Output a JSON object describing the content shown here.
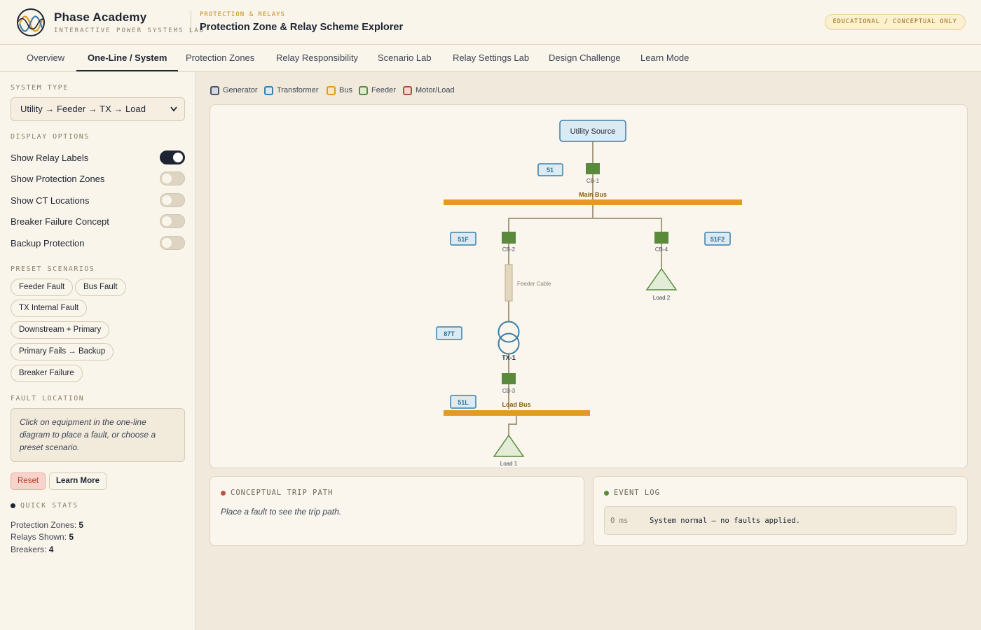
{
  "header": {
    "brand_name": "Phase Academy",
    "brand_sub": "INTERACTIVE POWER SYSTEMS LAB",
    "kicker": "PROTECTION & RELAYS",
    "title": "Protection Zone & Relay Scheme Explorer",
    "badge": "EDUCATIONAL / CONCEPTUAL ONLY"
  },
  "tabs": [
    {
      "label": "Overview"
    },
    {
      "label": "One-Line / System",
      "active": true
    },
    {
      "label": "Protection Zones"
    },
    {
      "label": "Relay Responsibility"
    },
    {
      "label": "Scenario Lab"
    },
    {
      "label": "Relay Settings Lab"
    },
    {
      "label": "Design Challenge"
    },
    {
      "label": "Learn Mode"
    }
  ],
  "sidebar": {
    "system_type_heading": "SYSTEM TYPE",
    "system_type_value": "Utility → Feeder → TX → Load",
    "display_heading": "DISPLAY OPTIONS",
    "display_options": [
      {
        "label": "Show Relay Labels",
        "on": true
      },
      {
        "label": "Show Protection Zones",
        "on": false
      },
      {
        "label": "Show CT Locations",
        "on": false
      },
      {
        "label": "Breaker Failure Concept",
        "on": false
      },
      {
        "label": "Backup Protection",
        "on": false
      }
    ],
    "preset_heading": "PRESET SCENARIOS",
    "presets": [
      "Feeder Fault",
      "Bus Fault",
      "TX Internal Fault",
      "Downstream + Primary",
      "Primary Fails → Backup",
      "Breaker Failure"
    ],
    "fault_heading": "FAULT LOCATION",
    "fault_text": "Click on equipment in the one-line diagram to place a fault, or choose a preset scenario.",
    "reset_label": "Reset",
    "learn_label": "Learn More",
    "stats_heading": "QUICK STATS",
    "stats": [
      {
        "label": "Protection Zones:",
        "value": "5"
      },
      {
        "label": "Relays Shown:",
        "value": "5"
      },
      {
        "label": "Breakers:",
        "value": "4"
      }
    ]
  },
  "legend": [
    {
      "label": "Generator",
      "border": "#4a5568",
      "fill": "#d4d8e0"
    },
    {
      "label": "Transformer",
      "border": "#3b7fa8",
      "fill": "#d8e8f0"
    },
    {
      "label": "Bus",
      "border": "#e39a24",
      "fill": "#f8e6c4"
    },
    {
      "label": "Feeder",
      "border": "#5a8a3c",
      "fill": "#e0ebd4"
    },
    {
      "label": "Motor/Load",
      "border": "#b84a3a",
      "fill": "#f3d8d2"
    }
  ],
  "diagram": {
    "utility_source": "Utility Source",
    "main_bus": "Main Bus",
    "load_bus": "Load Bus",
    "feeder_cable": "Feeder Cable",
    "transformer": "TX-1",
    "breakers": [
      "CB-1",
      "CB-2",
      "CB-3",
      "CB-4"
    ],
    "relays": [
      "51",
      "51F",
      "51F2",
      "87T",
      "51L"
    ],
    "loads": [
      "Load 1",
      "Load 2"
    ]
  },
  "trip_path": {
    "title": "CONCEPTUAL TRIP PATH",
    "text": "Place a fault to see the trip path."
  },
  "event_log": {
    "title": "EVENT LOG",
    "entries": [
      {
        "time": "0 ms",
        "message": "System normal — no faults applied."
      }
    ]
  },
  "colors": {
    "navy": "#1e2433",
    "bus_orange": "#e39a24",
    "breaker_green": "#5a8a3c",
    "relay_blue": "#3b7fa8",
    "alert_red": "#c0523d",
    "ok_green": "#5a8a3c"
  }
}
